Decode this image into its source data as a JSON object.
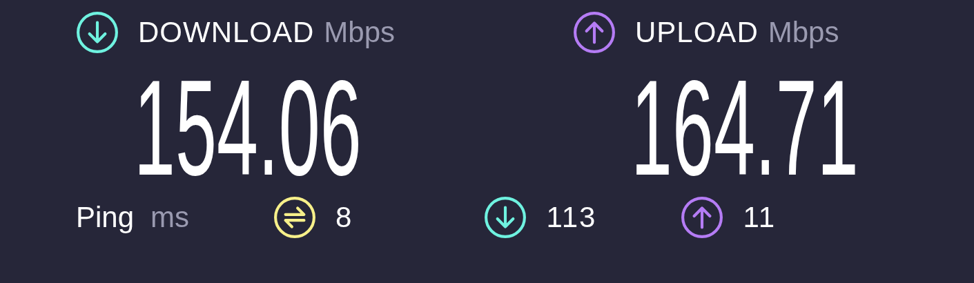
{
  "speeds": [
    {
      "kind": "download",
      "label": "DOWNLOAD",
      "unit": "Mbps",
      "value": "154.06"
    },
    {
      "kind": "upload",
      "label": "UPLOAD",
      "unit": "Mbps",
      "value": "164.71"
    }
  ],
  "ping": {
    "label": "Ping",
    "unit": "ms",
    "stats": [
      {
        "kind": "jitter",
        "value": "8"
      },
      {
        "kind": "download",
        "value": "113"
      },
      {
        "kind": "upload",
        "value": "11"
      }
    ]
  }
}
